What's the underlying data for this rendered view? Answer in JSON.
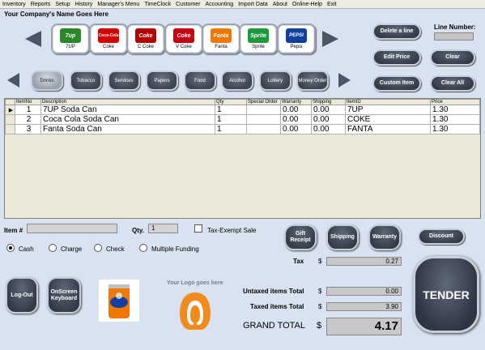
{
  "menu": [
    "Inventory",
    "Reports",
    "Setup",
    "History",
    "Manager's Menu",
    "TimeClock",
    "Customer",
    "Accounting",
    "Import Data",
    "About",
    "Online-Help",
    "Exit"
  ],
  "company_name": "Your Company's Name Goes Here",
  "products": [
    {
      "label": "7UP",
      "logo": "7up",
      "color": "#2a8a2a"
    },
    {
      "label": "Coke",
      "logo": "Coca-Cola",
      "color": "#d40000"
    },
    {
      "label": "C Coke",
      "logo": "Coke",
      "color": "#b30000"
    },
    {
      "label": "V Coke",
      "logo": "Coke",
      "color": "#c40010"
    },
    {
      "label": "Fanta",
      "logo": "Fanta",
      "color": "#f07800"
    },
    {
      "label": "Sprite",
      "logo": "Sprite",
      "color": "#1a9a3a"
    },
    {
      "label": "Pepsi",
      "logo": "PEPSI",
      "color": "#1040a0"
    }
  ],
  "categories": [
    "Drinks",
    "Tobacco",
    "Services",
    "Papers",
    "Food",
    "Alcohol",
    "Lottery",
    "Money Order"
  ],
  "buttons": {
    "delete_line": "Delete a line",
    "edit_price": "Edit Price",
    "clear": "Clear",
    "custom_item": "Custom Item",
    "clear_all": "Clear All",
    "gift_receipt": "Gift Receipt",
    "shipping": "Shipping",
    "warranty": "Warranty",
    "discount": "Discount",
    "logout": "Log-Out",
    "keyboard": "OnScreen Keyboard",
    "tender": "TENDER"
  },
  "line_number_label": "Line Number:",
  "grid": {
    "columns": [
      "",
      "ItemNo",
      "Description",
      "Qty",
      "Special Order",
      "Warranty",
      "Shipping",
      "ItemID",
      "Price"
    ],
    "rows": [
      {
        "no": "1",
        "desc": "7UP Soda Can",
        "qty": "1",
        "special": "",
        "warranty": "0.00",
        "shipping": "0.00",
        "id": "7UP",
        "price": "1.30"
      },
      {
        "no": "2",
        "desc": "Coca Cola Soda Can",
        "qty": "1",
        "special": "",
        "warranty": "0.00",
        "shipping": "0.00",
        "id": "COKE",
        "price": "1.30"
      },
      {
        "no": "3",
        "desc": "Fanta Soda Can",
        "qty": "1",
        "special": "",
        "warranty": "0.00",
        "shipping": "0.00",
        "id": "FANTA",
        "price": "1.30"
      }
    ]
  },
  "entry": {
    "item_label": "Item #",
    "qty_label": "Qty.",
    "qty_value": "1",
    "tax_exempt": "Tax-Exempt Sale"
  },
  "payment": [
    "Cash",
    "Charge",
    "Check",
    "Multiple Funding"
  ],
  "logo_text": "Your Logo goes here",
  "totals": {
    "tax_label": "Tax",
    "tax_value": "0.27",
    "untaxed_label": "Untaxed items Total",
    "untaxed_value": "0.00",
    "taxed_label": "Taxed items Total",
    "taxed_value": "3.90",
    "grand_label": "GRAND TOTAL",
    "grand_value": "4.17",
    "currency": "$"
  },
  "colors": {
    "background": "#d8e2f0",
    "button_dark": "#3e4552"
  }
}
